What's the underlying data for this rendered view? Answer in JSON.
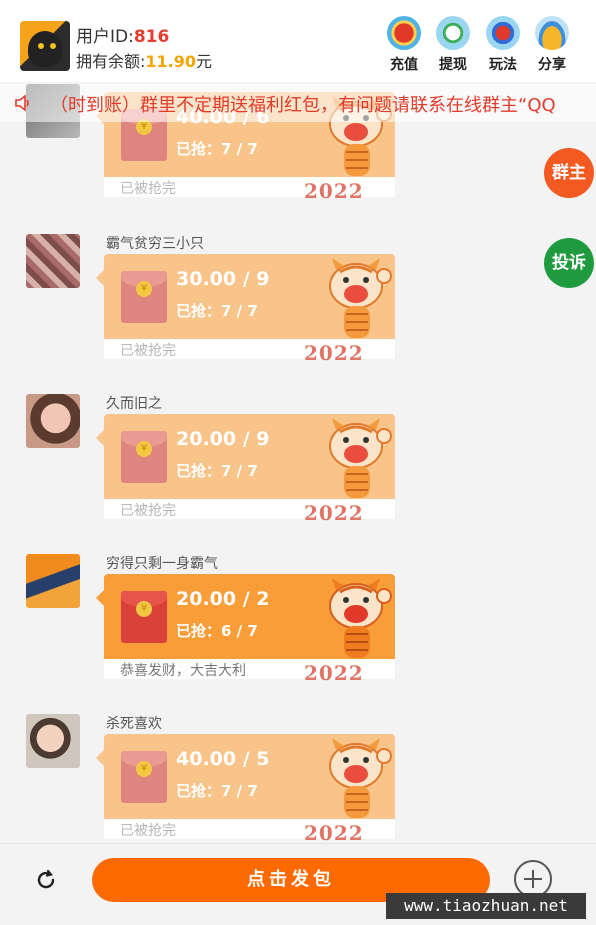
{
  "header": {
    "user_id_label": "用户ID:",
    "user_id": "816",
    "balance_label": "拥有余额:",
    "balance": "11.90",
    "balance_unit": "元",
    "nav": [
      {
        "label": "充值",
        "icon": "recharge-icon"
      },
      {
        "label": "提现",
        "icon": "withdraw-icon"
      },
      {
        "label": "玩法",
        "icon": "rules-icon"
      },
      {
        "label": "分享",
        "icon": "share-icon"
      }
    ]
  },
  "notice": {
    "text": "（时到账）群里不定期送福利红包，有问题请联系在线群主“QQ"
  },
  "side_buttons": {
    "owner": "群主",
    "complain": "投诉"
  },
  "messages": [
    {
      "name": "",
      "amount": "40.00 / 6",
      "grabbed": "已抢：7 / 7",
      "status": "已被抢完",
      "active": false
    },
    {
      "name": "霸气贫穷三小只",
      "amount": "30.00 / 9",
      "grabbed": "已抢：7 / 7",
      "status": "已被抢完",
      "active": false
    },
    {
      "name": "久而旧之",
      "amount": "20.00 / 9",
      "grabbed": "已抢：7 / 7",
      "status": "已被抢完",
      "active": false
    },
    {
      "name": "穷得只剩一身霸气",
      "amount": "20.00 / 2",
      "grabbed": "已抢：6 / 7",
      "status": "恭喜发财，大吉大利",
      "active": true
    },
    {
      "name": "杀死喜欢",
      "amount": "40.00 / 5",
      "grabbed": "已抢：7 / 7",
      "status": "已被抢完",
      "active": false
    }
  ],
  "packet_year": "2022",
  "footer": {
    "send_label": "点击发包"
  },
  "watermark": "www.tiaozhuan.net",
  "colors": {
    "accent": "#ff6a00",
    "packet_idle": "#f9c48a",
    "packet_active": "#f99d38",
    "owner_btn": "#f25a22",
    "complain_btn": "#1f9a3e"
  }
}
